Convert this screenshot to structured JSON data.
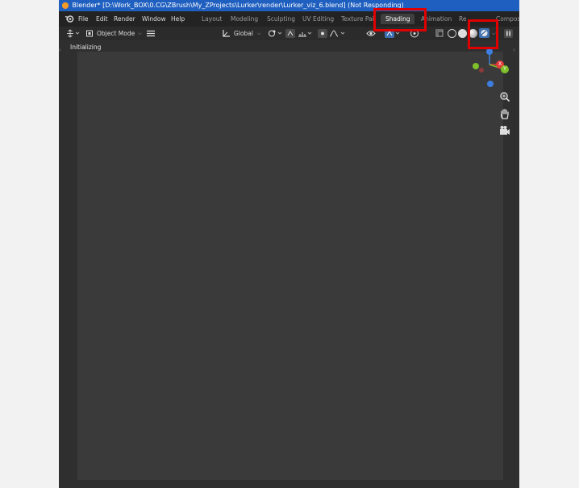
{
  "window": {
    "title": "Blender* [D:\\Work_BOX\\0.CG\\ZBrush\\My_ZProjects\\Lurker\\render\\Lurker_viz_6.blend] (Not Responding)"
  },
  "menubar": {
    "items": [
      "File",
      "Edit",
      "Render",
      "Window",
      "Help"
    ],
    "workspace_tabs": [
      "Layout",
      "Modeling",
      "Sculpting",
      "UV Editing",
      "Texture Pai",
      "Shading",
      "Animation",
      "Re",
      "Compos"
    ],
    "active_tab": "Shading"
  },
  "toolbar": {
    "mode": "Object Mode",
    "orientation": "Global"
  },
  "viewport": {
    "status": "Initializing"
  },
  "gizmo": {
    "z_label": "Z",
    "x_label": "X",
    "y_label": "Y"
  },
  "colors": {
    "accent_red": "#e00000",
    "title_blue": "#1f5fbf",
    "axis_x": "#e33b3b",
    "axis_y": "#7fbf2a",
    "axis_z": "#3d7ee0"
  }
}
